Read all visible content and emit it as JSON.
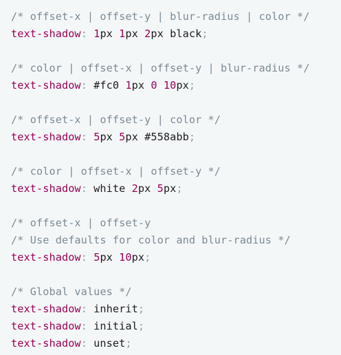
{
  "colors": {
    "background": "#f4f7f8",
    "comment": "#7a8a93",
    "property": "#990055",
    "number": "#990055",
    "punctuation": "#909ba3",
    "text": "#1b1b1b"
  },
  "code": {
    "c1": "/* offset-x | offset-y | blur-radius | color */",
    "l1": {
      "prop": "text-shadow",
      "colon": ":",
      "n1": "1",
      "u1": "px ",
      "n2": "1",
      "u2": "px ",
      "n3": "2",
      "u3": "px black",
      "semi": ";"
    },
    "c2": "/* color | offset-x | offset-y | blur-radius */",
    "l2": {
      "prop": "text-shadow",
      "colon": ":",
      "t1": " #fc0 ",
      "n1": "1",
      "u1": "px ",
      "n2": "0",
      "sp": " ",
      "n3": "10",
      "u3": "px",
      "semi": ";"
    },
    "c3": "/* offset-x | offset-y | color */",
    "l3": {
      "prop": "text-shadow",
      "colon": ":",
      "sp": " ",
      "n1": "5",
      "u1": "px ",
      "n2": "5",
      "u2": "px #558abb",
      "semi": ";"
    },
    "c4": "/* color | offset-x | offset-y */",
    "l4": {
      "prop": "text-shadow",
      "colon": ":",
      "t1": " white ",
      "n1": "2",
      "u1": "px ",
      "n2": "5",
      "u2": "px",
      "semi": ";"
    },
    "c5a": "/* offset-x | offset-y",
    "c5b": "/* Use defaults for color and blur-radius */",
    "l5": {
      "prop": "text-shadow",
      "colon": ":",
      "sp": " ",
      "n1": "5",
      "u1": "px ",
      "n2": "10",
      "u2": "px",
      "semi": ";"
    },
    "c6": "/* Global values */",
    "g1": {
      "prop": "text-shadow",
      "colon": ":",
      "val": " inherit",
      "semi": ";"
    },
    "g2": {
      "prop": "text-shadow",
      "colon": ":",
      "val": " initial",
      "semi": ";"
    },
    "g3": {
      "prop": "text-shadow",
      "colon": ":",
      "val": " unset",
      "semi": ";"
    }
  }
}
